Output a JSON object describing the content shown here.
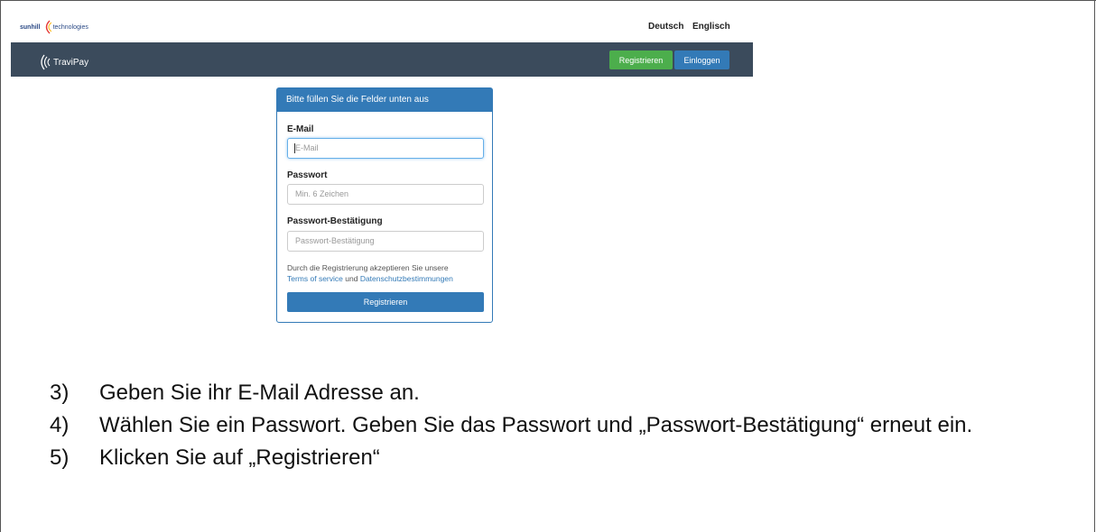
{
  "topbar": {
    "company_logo_text_1": "sunhill",
    "company_logo_text_2": "technologies",
    "lang_de": "Deutsch",
    "lang_en": "Englisch"
  },
  "navbar": {
    "brand": "TraviPay",
    "register_label": "Registrieren",
    "login_label": "Einloggen",
    "bg_color": "#3b4b5c"
  },
  "form": {
    "heading": "Bitte füllen Sie die Felder unten aus",
    "email_label": "E-Mail",
    "email_placeholder": "E-Mail",
    "password_label": "Passwort",
    "password_placeholder": "Min. 6 Zeichen",
    "confirm_label": "Passwort-Bestätigung",
    "confirm_placeholder": "Passwort-Bestätigung",
    "terms_prefix": "Durch die Registrierung akzeptieren Sie unsere",
    "terms_link": "Terms of service",
    "terms_and": "und",
    "privacy_link": "Datenschutzbestimmungen",
    "submit_label": "Registrieren",
    "accent_color": "#337ab7"
  },
  "instructions": [
    {
      "num": "3)",
      "text": "Geben Sie ihr E-Mail Adresse an."
    },
    {
      "num": "4)",
      "text": "Wählen Sie ein Passwort. Geben Sie das Passwort und „Passwort-Bestätigung“ erneut ein."
    },
    {
      "num": "5)",
      "text": "Klicken Sie auf „Registrieren“"
    }
  ]
}
